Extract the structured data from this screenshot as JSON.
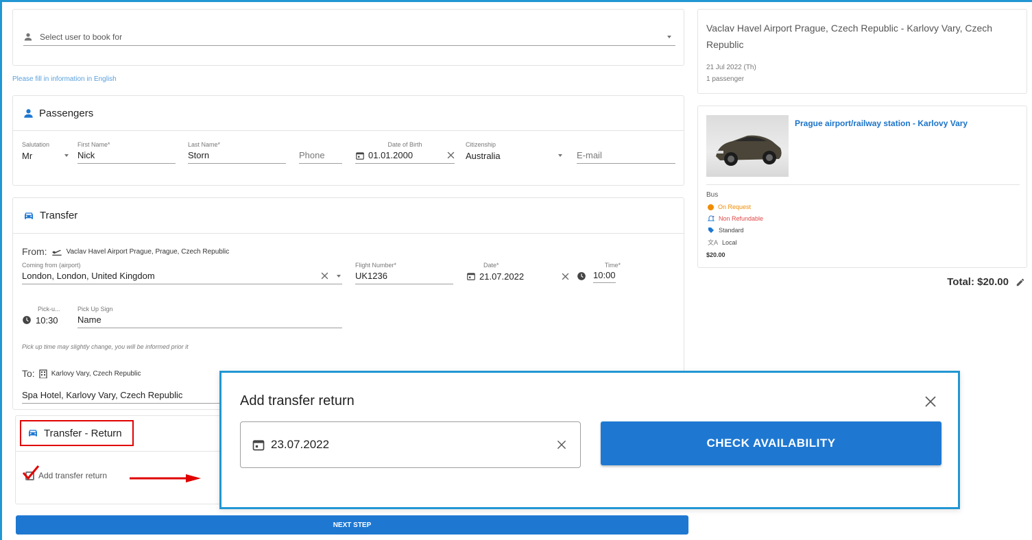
{
  "colors": {
    "accent": "#1e78d2",
    "link": "#1a73c9",
    "warning": "#f08c00",
    "danger": "#e04848",
    "highlight": "#e00000",
    "frame": "#2196d3"
  },
  "user_select": {
    "placeholder": "Select user to book for"
  },
  "english_note": "Please fill in information in English",
  "passengers": {
    "title": "Passengers",
    "salutation": {
      "label": "Salutation",
      "value": "Mr"
    },
    "first_name": {
      "label": "First Name*",
      "value": "Nick"
    },
    "last_name": {
      "label": "Last Name*",
      "value": "Storn"
    },
    "phone": {
      "placeholder": "Phone"
    },
    "dob": {
      "label": "Date of Birth",
      "value": "01.01.2000"
    },
    "citizenship": {
      "label": "Citizenship",
      "value": "Australia"
    },
    "email": {
      "placeholder": "E-mail"
    }
  },
  "transfer": {
    "title": "Transfer",
    "from_label": "From:",
    "from_place": "Vaclav Havel Airport Prague, Prague, Czech Republic",
    "coming_from": {
      "label": "Coming from (airport)",
      "value": "London, London, United Kingdom"
    },
    "flight_number": {
      "label": "Flight Number*",
      "value": "UK1236"
    },
    "date": {
      "label": "Date*",
      "value": "21.07.2022"
    },
    "time": {
      "label": "Time*",
      "value": "10:00"
    },
    "pickup_time": {
      "label": "Pick-u...",
      "value": "10:30"
    },
    "pickup_sign": {
      "label": "Pick Up Sign",
      "value": "Name"
    },
    "pickup_note": "Pick up time may slightly change, you will be informed prior it",
    "to_label": "To:",
    "to_place": "Karlovy Vary, Czech Republic",
    "to_address": "Spa Hotel, Karlovy Vary, Czech Republic"
  },
  "transfer_return": {
    "title": "Transfer - Return",
    "checkbox_label": "Add transfer return"
  },
  "next_step_label": "NEXT STEP",
  "summary": {
    "route": "Vaclav Havel Airport Prague, Czech Republic - Karlovy Vary, Czech Republic",
    "date": "21 Jul 2022 (Th)",
    "passengers": "1 passenger"
  },
  "product": {
    "name": "Prague airport/railway station - Karlovy Vary",
    "vehicle_type": "Bus",
    "on_request": "On Request",
    "refund": "Non Refundable",
    "class": "Standard",
    "language": "Local",
    "price": "$20.00"
  },
  "total": "Total: $20.00",
  "modal": {
    "title": "Add transfer return",
    "date_value": "23.07.2022",
    "button_label": "CHECK AVAILABILITY"
  }
}
